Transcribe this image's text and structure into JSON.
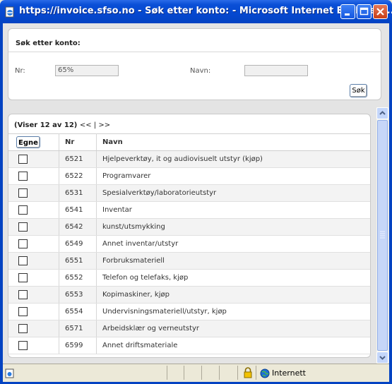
{
  "window": {
    "title": "https://invoice.sfso.no - Søk etter konto: - Microsoft Internet Explorer ..."
  },
  "search": {
    "heading": "Søk etter konto:",
    "nr_label": "Nr:",
    "nr_value": "65%",
    "navn_label": "Navn:",
    "navn_value": "",
    "button_label": "Søk"
  },
  "list": {
    "summary": "(Viser 12 av 12)",
    "nav": "<< | >>",
    "egne_button": "Egne",
    "col_nr": "Nr",
    "col_navn": "Navn",
    "rows": [
      {
        "nr": "6521",
        "navn": "Hjelpeverktøy, it og audiovisuelt utstyr (kjøp)"
      },
      {
        "nr": "6522",
        "navn": "Programvarer"
      },
      {
        "nr": "6531",
        "navn": "Spesialverktøy/laboratorieutstyr"
      },
      {
        "nr": "6541",
        "navn": "Inventar"
      },
      {
        "nr": "6542",
        "navn": "kunst/utsmykking"
      },
      {
        "nr": "6549",
        "navn": "Annet inventar/utstyr"
      },
      {
        "nr": "6551",
        "navn": "Forbruksmateriell"
      },
      {
        "nr": "6552",
        "navn": "Telefon og telefaks, kjøp"
      },
      {
        "nr": "6553",
        "navn": "Kopimaskiner, kjøp"
      },
      {
        "nr": "6554",
        "navn": "Undervisningsmateriell/utstyr, kjøp"
      },
      {
        "nr": "6571",
        "navn": "Arbeidsklær og verneutstyr"
      },
      {
        "nr": "6599",
        "navn": "Annet driftsmateriale"
      }
    ]
  },
  "statusbar": {
    "zone": "Internett"
  },
  "icons": {
    "app": "ie-page-icon",
    "minimize": "minimize-icon",
    "maximize": "maximize-icon",
    "close": "close-icon",
    "lock": "lock-icon",
    "globe": "globe-icon"
  },
  "colors": {
    "titlebar": "#0548d0",
    "link": "#000000",
    "row_alt": "#f3f3f3"
  }
}
